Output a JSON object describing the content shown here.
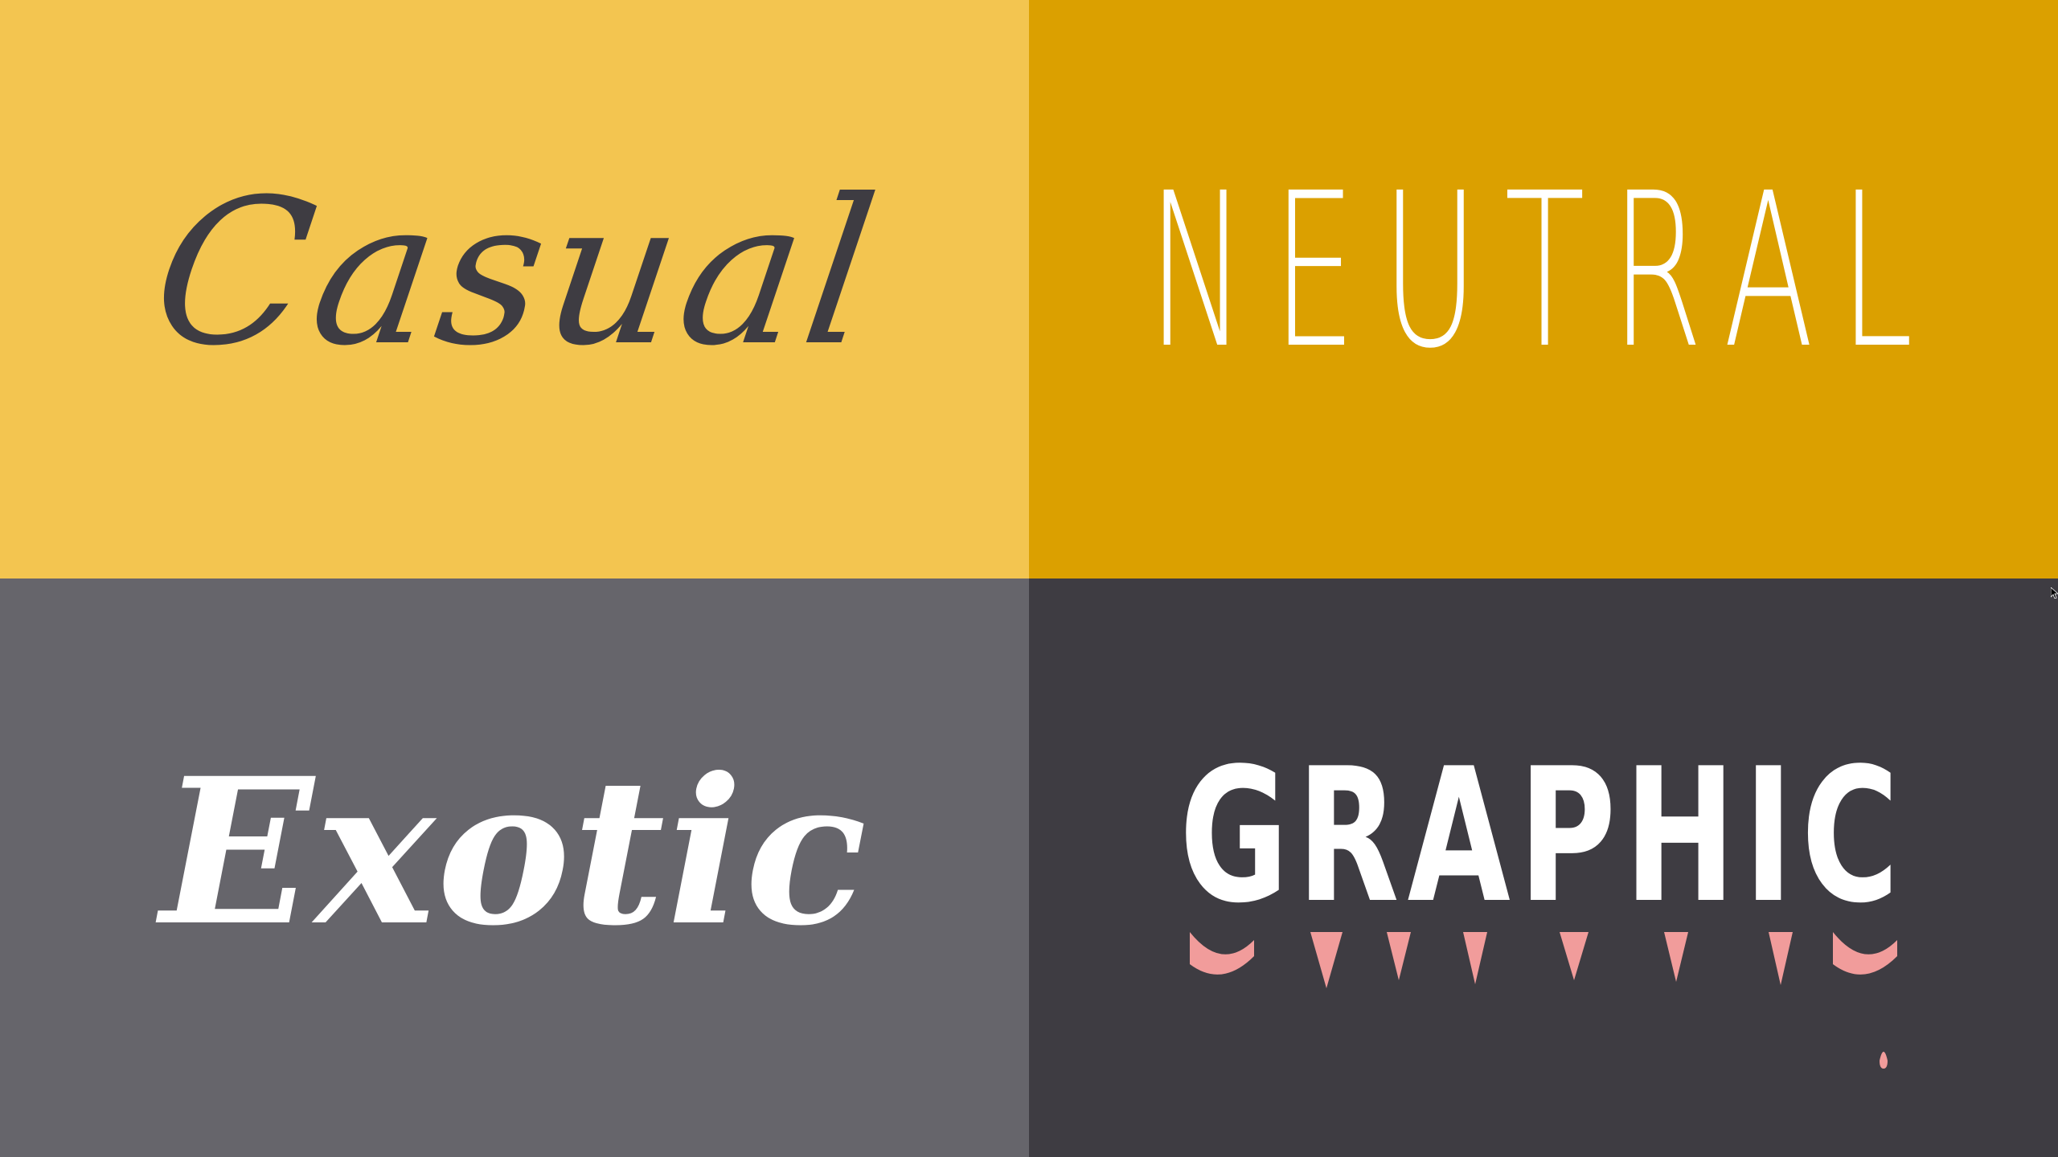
{
  "colors": {
    "casual_bg": "#f3c550",
    "casual_text": "#3e3c42",
    "neutral_bg": "#dba000",
    "neutral_text": "#ffffff",
    "exotic_bg": "#66656b",
    "exotic_text": "#ffffff",
    "graphic_bg": "#3e3c42",
    "graphic_text": "#ffffff",
    "graphic_drip": "#f19c9b"
  },
  "panels": {
    "casual": "Casual",
    "neutral": "NEUTRAL",
    "exotic": "Exotic",
    "graphic": "GRAPHIC"
  }
}
